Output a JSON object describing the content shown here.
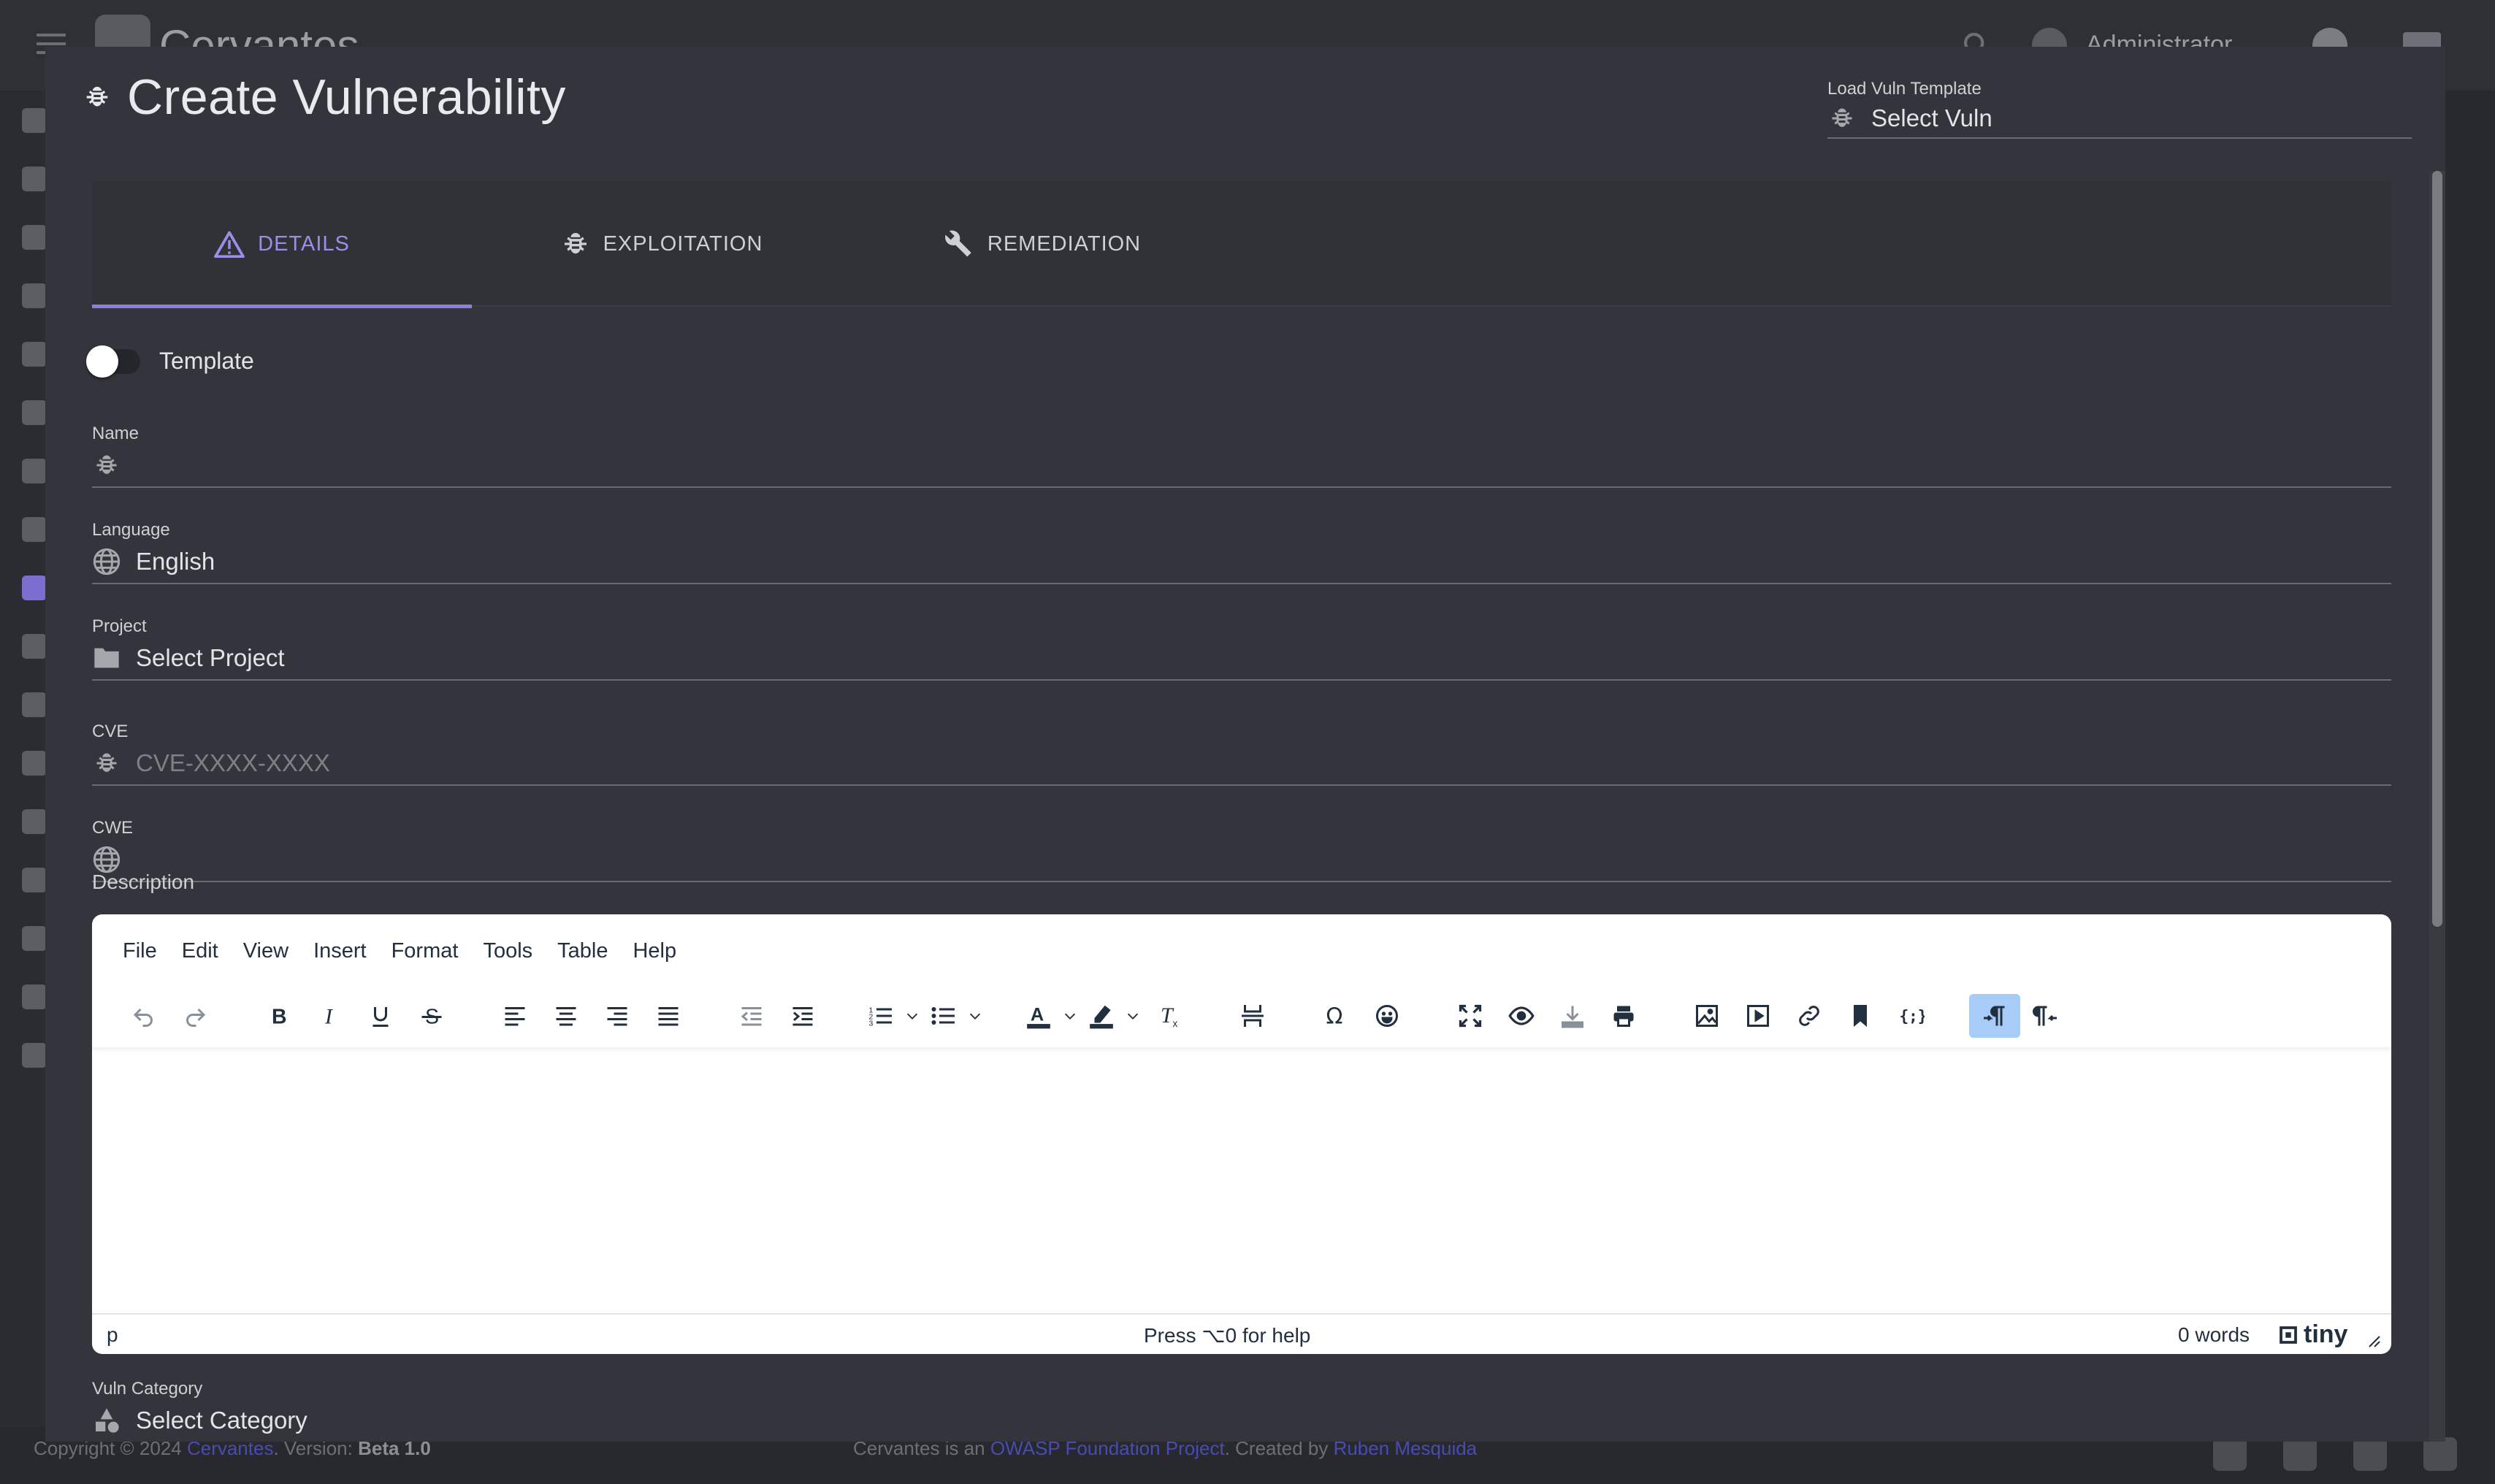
{
  "app": {
    "brand": "Cervantes",
    "user": "Administrator"
  },
  "footer": {
    "copyright_prefix": "Copyright © 2024 ",
    "brand_link": "Cervantes",
    "version_prefix": ". Version: ",
    "version": "Beta 1.0",
    "credits_prefix": "Cervantes is an ",
    "foundation_link": "OWASP Foundation Project",
    "credits_mid": ". Created by ",
    "author_link": "Ruben Mesquida"
  },
  "modal": {
    "title": "Create Vulnerability",
    "template_loader": {
      "label": "Load Vuln Template",
      "placeholder": "Select Vuln"
    },
    "tabs": [
      {
        "label": "DETAILS",
        "icon": "warning-icon",
        "active": true
      },
      {
        "label": "EXPLOITATION",
        "icon": "bug-icon",
        "active": false
      },
      {
        "label": "REMEDIATION",
        "icon": "wrench-icon",
        "active": false
      }
    ],
    "template_toggle": {
      "label": "Template",
      "on": false
    },
    "fields": {
      "name": {
        "label": "Name",
        "value": ""
      },
      "language": {
        "label": "Language",
        "value": "English"
      },
      "project": {
        "label": "Project",
        "value": "Select Project"
      },
      "cve": {
        "label": "CVE",
        "placeholder": "CVE-XXXX-XXXX"
      },
      "cwe": {
        "label": "CWE",
        "value": ""
      },
      "description": {
        "label": "Description"
      },
      "vuln_category": {
        "label": "Vuln Category",
        "value": "Select Category"
      }
    },
    "editor": {
      "menu": [
        "File",
        "Edit",
        "View",
        "Insert",
        "Format",
        "Tools",
        "Table",
        "Help"
      ],
      "status_path": "p",
      "status_help": "Press ⌥0 for help",
      "word_count": "0 words",
      "brand": "tiny"
    }
  },
  "colors": {
    "accent": "#8b7fe0",
    "modal_bg": "#34353c",
    "page_bg": "#28292e"
  }
}
